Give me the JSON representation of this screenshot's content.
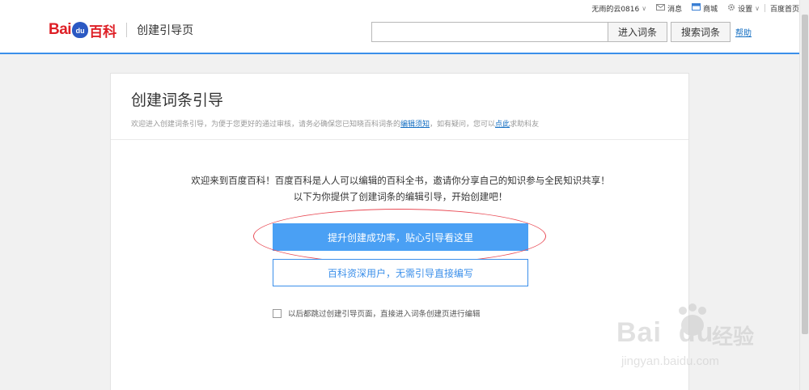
{
  "topbar": {
    "username": "无雨的云0816",
    "messages": "消息",
    "mall": "商城",
    "settings": "设置",
    "home": "百度首页"
  },
  "logo": {
    "bai": "Bai",
    "du": "du",
    "baike": "百科",
    "page_title": "创建引导页"
  },
  "search": {
    "value": "",
    "enter_label": "进入词条",
    "search_label": "搜索词条",
    "help_label": "帮助"
  },
  "panel": {
    "title": "创建词条引导",
    "desc_prefix": "欢迎进入创建词条引导，为便于您更好的通过审核，请务必确保您已知晓百科词条的",
    "desc_link1": "编辑须知",
    "desc_middle": "，如有疑问，您可以",
    "desc_link2": "点此",
    "desc_suffix": "求助科友",
    "welcome_line1": "欢迎来到百度百科！百度百科是人人可以编辑的百科全书，邀请你分享自己的知识参与全民知识共享！",
    "welcome_line2": "以下为你提供了创建词条的编辑引导，开始创建吧！",
    "guide_button": "提升创建成功率，贴心引导看这里",
    "skip_button": "百科资深用户，无需引导直接编写",
    "skip_checkbox_label": "以后都跳过创建引导页面，直接进入词条创建页进行编辑"
  },
  "watermark": {
    "main": "Bai",
    "du": "du",
    "jingyan": "经验",
    "url": "jingyan.baidu.com"
  },
  "colors": {
    "accent": "#3b8fea",
    "primary_button": "#4aa0f4",
    "logo_red": "#de1f26",
    "logo_blue": "#2b59c3",
    "annotation_red": "#e94b55"
  }
}
